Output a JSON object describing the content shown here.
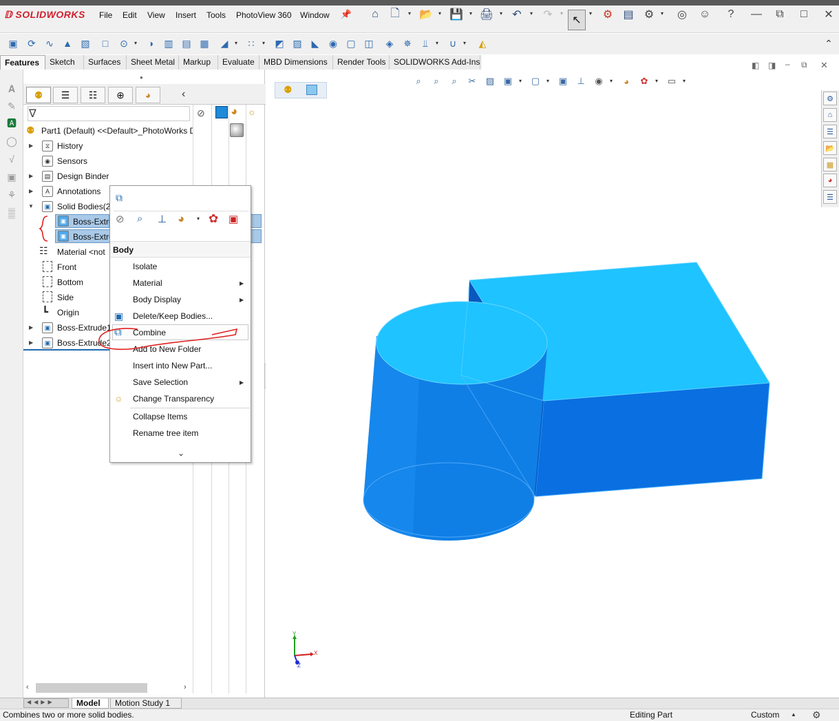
{
  "app": {
    "brand": "SOLIDWORKS"
  },
  "menu": {
    "items": [
      "File",
      "Edit",
      "View",
      "Insert",
      "Tools",
      "PhotoView 360",
      "Window"
    ]
  },
  "command_tabs": [
    "Features",
    "Sketch",
    "Surfaces",
    "Sheet Metal",
    "Markup",
    "Evaluate",
    "MBD Dimensions",
    "Render Tools",
    "SOLIDWORKS Add-Ins"
  ],
  "feature_tree": {
    "root": "Part1 (Default) <<Default>_PhotoWorks D",
    "items": {
      "history": "History",
      "sensors": "Sensors",
      "design_binder": "Design Binder",
      "annotations": "Annotations",
      "solid_bodies": "Solid Bodies(2)",
      "boss1_body": "Boss-Extru",
      "boss2_body": "Boss-Extrude2",
      "material": "Material <not",
      "front": "Front",
      "bottom": "Bottom",
      "side": "Side",
      "origin": "Origin",
      "boss_extrude1": "Boss-Extrude1",
      "boss_extrude2": "Boss-Extrude2"
    }
  },
  "context_menu": {
    "header": "Body",
    "items": {
      "isolate": "Isolate",
      "material": "Material",
      "body_display": "Body Display",
      "delete_keep": "Delete/Keep Bodies...",
      "combine": "Combine",
      "add_folder": "Add to New Folder",
      "insert_part": "Insert into New Part...",
      "save_selection": "Save Selection",
      "change_transparency": "Change Transparency",
      "collapse": "Collapse Items",
      "rename": "Rename tree item"
    }
  },
  "triad": {
    "x": "X",
    "y": "Y",
    "z": "Z"
  },
  "bottom_tabs": {
    "model": "Model",
    "motion": "Motion Study 1"
  },
  "status": {
    "hint": "Combines two or more solid bodies.",
    "mode": "Editing Part",
    "units": "Custom"
  },
  "colors": {
    "body_top": "#1ec3ff",
    "body_side": "#0f7fe6",
    "body_front": "#0a6fe0",
    "annotation_red": "#e02020",
    "selection_blue": "#a9c9e8"
  }
}
